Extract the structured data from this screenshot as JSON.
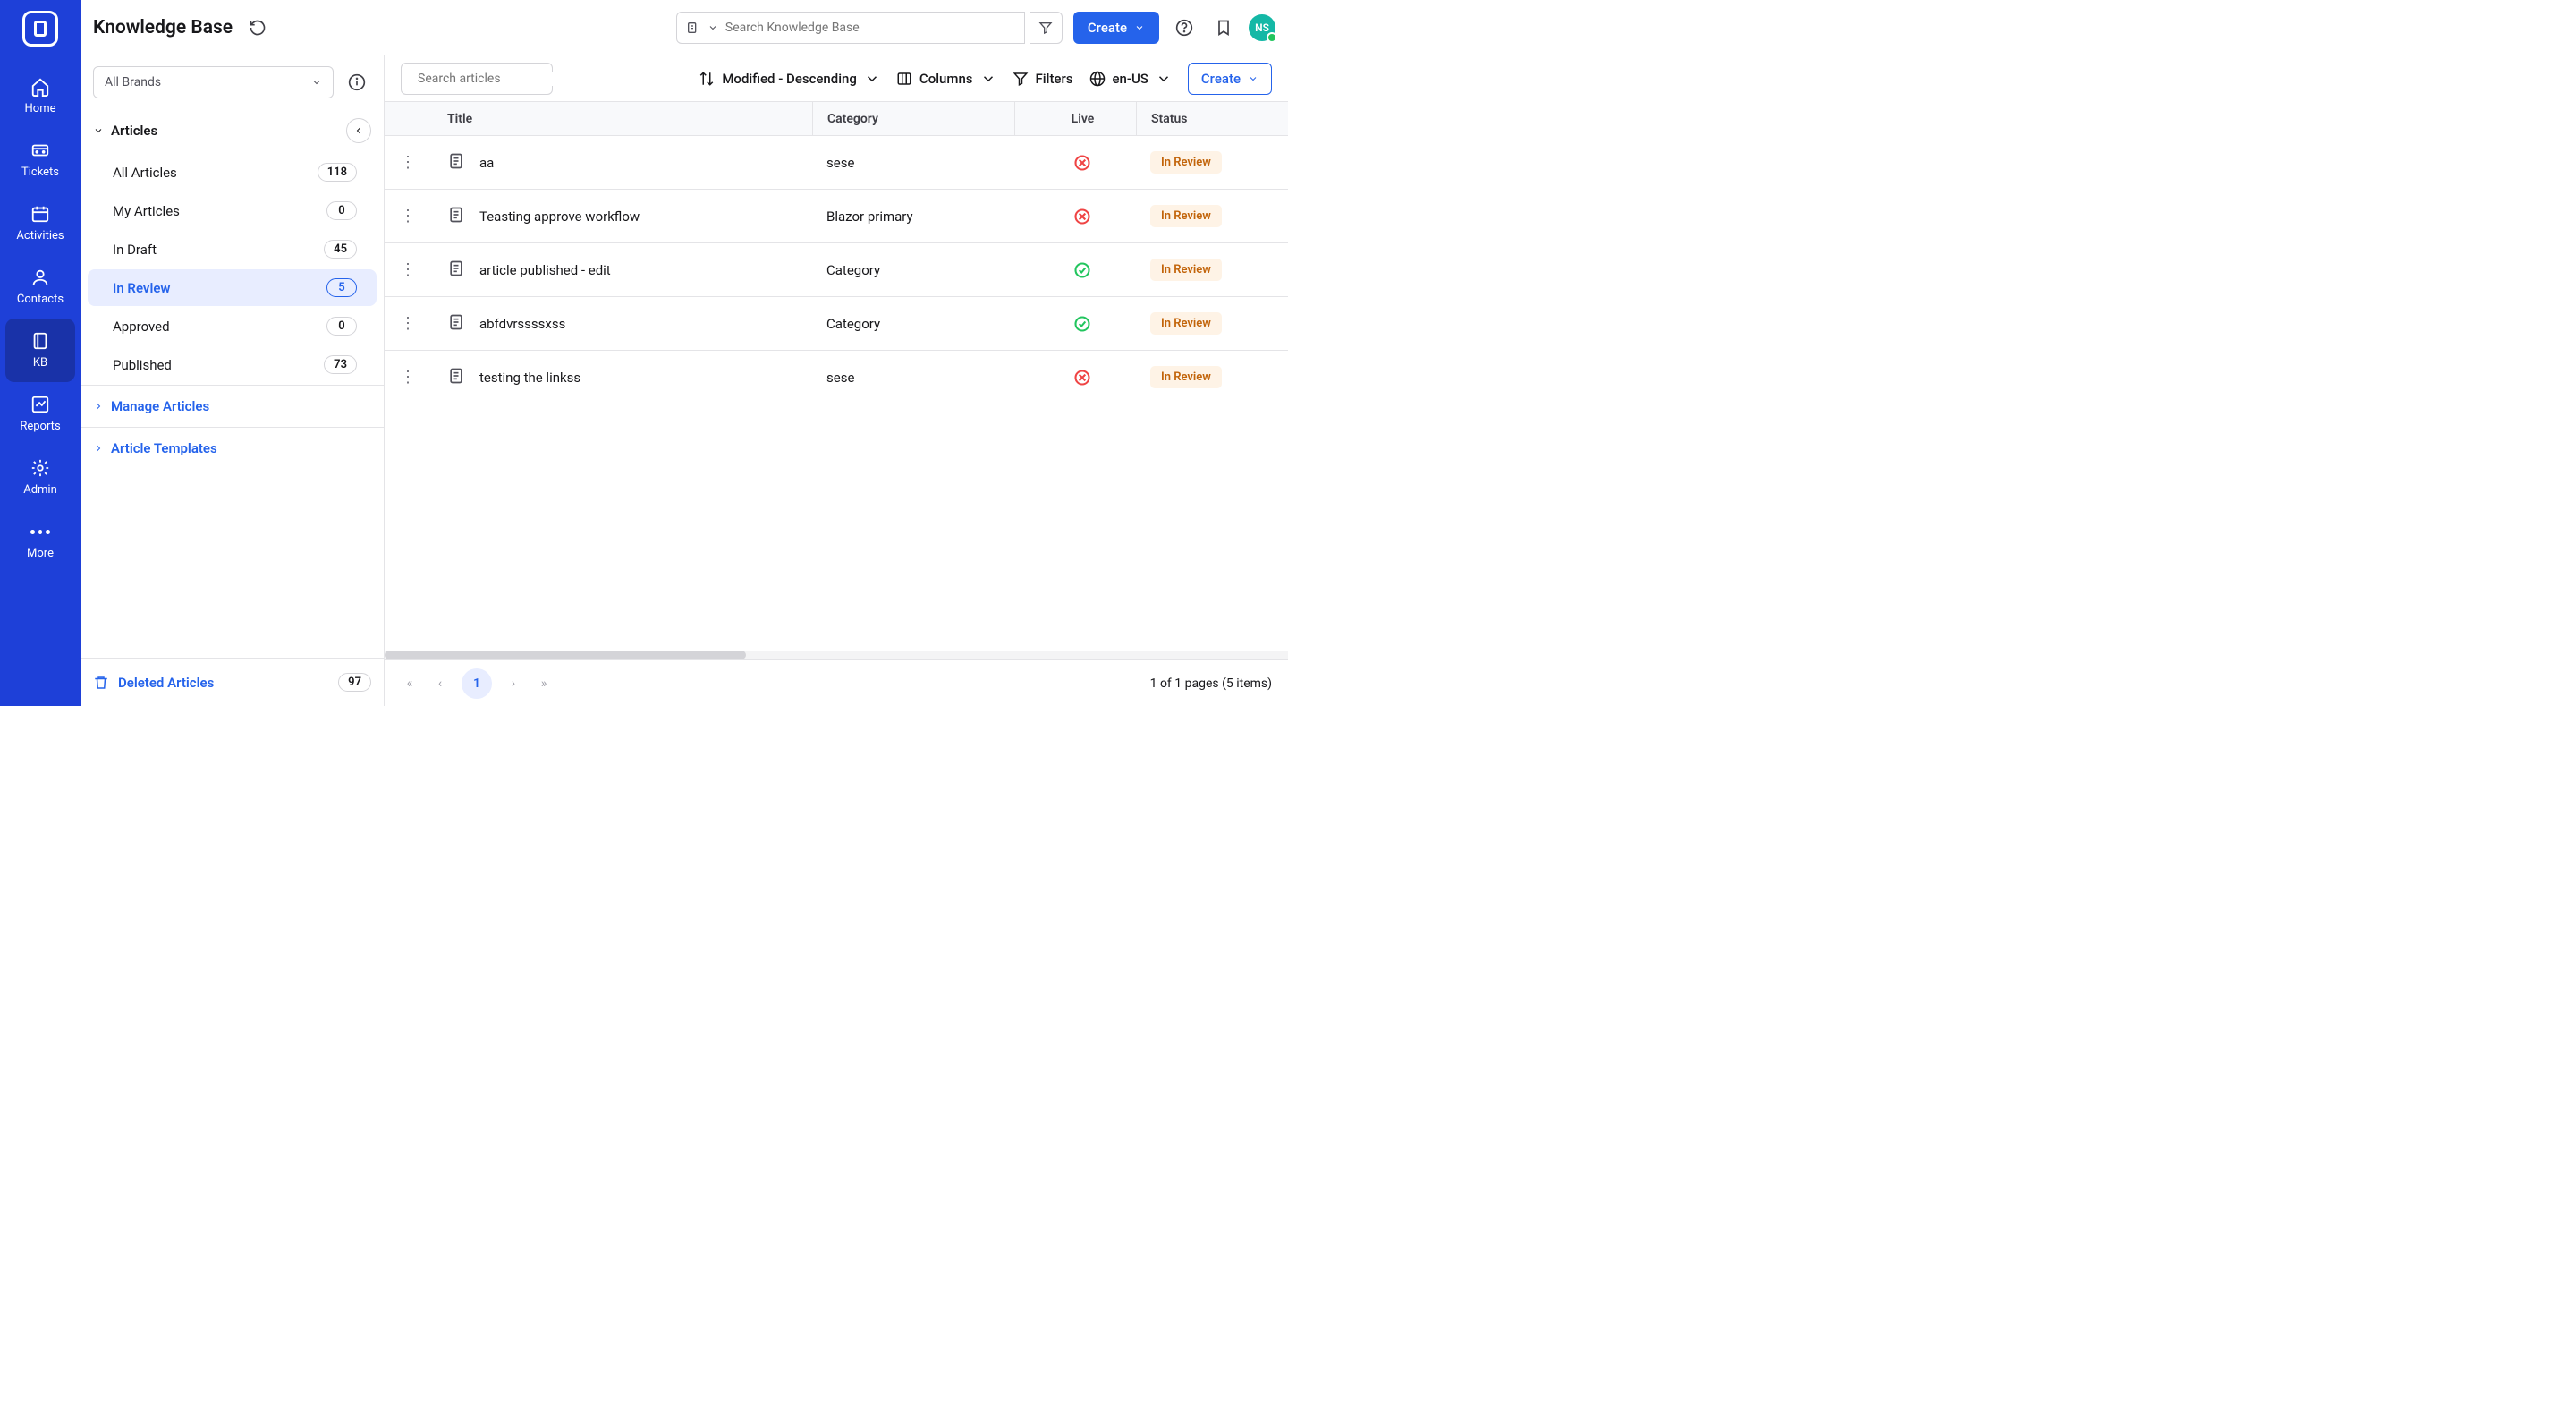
{
  "header": {
    "title": "Knowledge Base",
    "search_placeholder": "Search Knowledge Base",
    "create_label": "Create",
    "avatar_initials": "NS"
  },
  "sidebar_nav": [
    {
      "label": "Home",
      "icon": "home"
    },
    {
      "label": "Tickets",
      "icon": "ticket"
    },
    {
      "label": "Activities",
      "icon": "calendar"
    },
    {
      "label": "Contacts",
      "icon": "user"
    },
    {
      "label": "KB",
      "icon": "book",
      "active": true
    },
    {
      "label": "Reports",
      "icon": "chart"
    },
    {
      "label": "Admin",
      "icon": "gear"
    },
    {
      "label": "More",
      "icon": "dots"
    }
  ],
  "left_panel": {
    "brand_filter": "All Brands",
    "articles_header": "Articles",
    "filters": [
      {
        "label": "All Articles",
        "count": "118"
      },
      {
        "label": "My Articles",
        "count": "0"
      },
      {
        "label": "In Draft",
        "count": "45"
      },
      {
        "label": "In Review",
        "count": "5",
        "active": true
      },
      {
        "label": "Approved",
        "count": "0"
      },
      {
        "label": "Published",
        "count": "73"
      }
    ],
    "manage_label": "Manage Articles",
    "templates_label": "Article Templates",
    "deleted_label": "Deleted Articles",
    "deleted_count": "97"
  },
  "toolbar": {
    "search_placeholder": "Search articles",
    "sort_label": "Modified - Descending",
    "columns_label": "Columns",
    "filters_label": "Filters",
    "locale_label": "en-US",
    "create_label": "Create"
  },
  "table": {
    "columns": {
      "title": "Title",
      "category": "Category",
      "live": "Live",
      "status": "Status"
    },
    "rows": [
      {
        "title": "aa",
        "category": "sese",
        "live": false,
        "status": "In Review"
      },
      {
        "title": "Teasting approve workflow",
        "category": "Blazor primary",
        "live": false,
        "status": "In Review"
      },
      {
        "title": "article published - edit",
        "category": "Category",
        "live": true,
        "status": "In Review"
      },
      {
        "title": "abfdvrssssxss",
        "category": "Category",
        "live": true,
        "status": "In Review"
      },
      {
        "title": "testing the linkss",
        "category": "sese",
        "live": false,
        "status": "In Review"
      }
    ]
  },
  "pager": {
    "current": "1",
    "summary": "1 of 1 pages (5 items)"
  }
}
